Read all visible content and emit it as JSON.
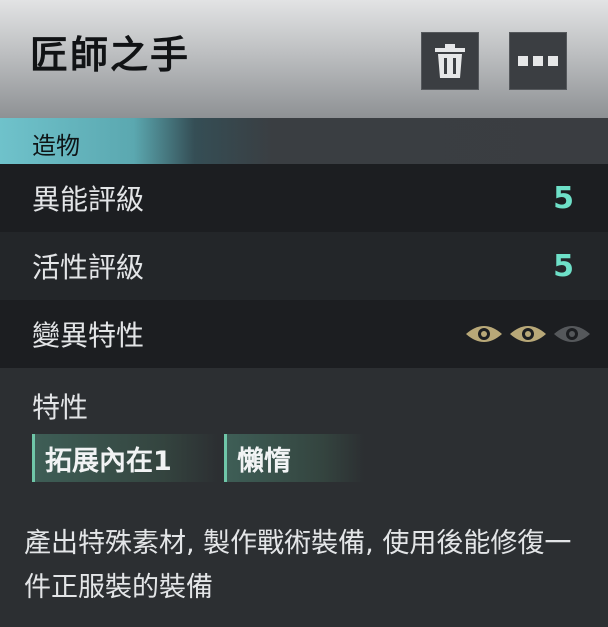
{
  "header": {
    "title": "匠師之手",
    "delete_icon": "trash-icon",
    "more_icon": "more-icon"
  },
  "category": {
    "label": "造物"
  },
  "stats": [
    {
      "label": "異能評級",
      "value": "5"
    },
    {
      "label": "活性評級",
      "value": "5"
    }
  ],
  "mutation": {
    "label": "變異特性",
    "eyes_filled": 2,
    "eyes_total": 3,
    "eye_color_active": "#b8a878",
    "eye_color_inactive": "#55585b"
  },
  "traits": {
    "label": "特性",
    "tags": [
      "拓展內在1",
      "懶惰"
    ]
  },
  "description": "產出特殊素材, 製作戰術裝備, 使用後能修復一件正服裝的裝備",
  "colors": {
    "accent_cyan": "#6fc2cb",
    "value_green": "#6ee0c8"
  }
}
